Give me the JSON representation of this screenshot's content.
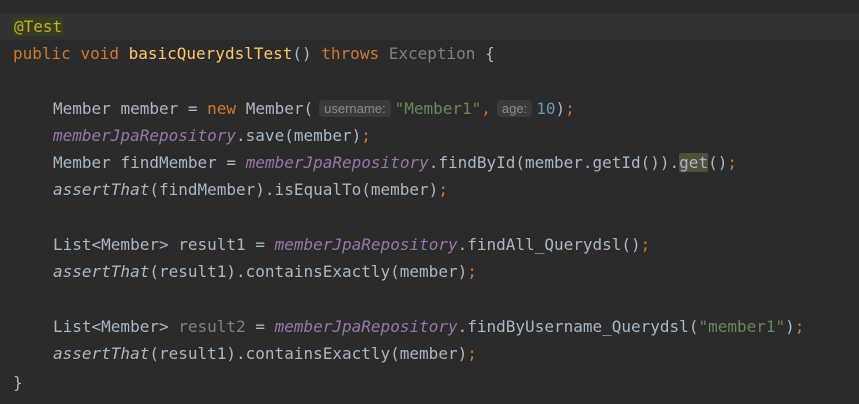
{
  "code": {
    "annotation": "@Test",
    "sig": {
      "kw_public": "public",
      "kw_void": "void",
      "method_name": "basicQuerydslTest",
      "parens": "()",
      "kw_throws": "throws",
      "exception": "Exception",
      "brace_open": "{"
    },
    "l3": {
      "type": "Member",
      "var": "member",
      "eq": "=",
      "kw_new": "new",
      "ctor": "Member(",
      "hint_username": "username:",
      "str_member1": "\"Member1\"",
      "comma": ",",
      "hint_age": "age:",
      "num_age": "10",
      "close": ")",
      "semi": ";"
    },
    "l4": {
      "field": "memberJpaRepository",
      "call": ".save(member)",
      "semi": ";"
    },
    "l5": {
      "type": "Member",
      "var": "findMember",
      "eq": "=",
      "field": "memberJpaRepository",
      "call": ".findById(member.getId()).",
      "get": "get",
      "tail": "()",
      "semi": ";"
    },
    "l6": {
      "fn": "assertThat",
      "call": "(findMember).isEqualTo(member)",
      "semi": ";"
    },
    "l8": {
      "type": "List<Member>",
      "var": "result1",
      "eq": "=",
      "field": "memberJpaRepository",
      "call": ".findAll_Querydsl()",
      "semi": ";"
    },
    "l9": {
      "fn": "assertThat",
      "call": "(result1).containsExactly(member)",
      "semi": ";"
    },
    "l11": {
      "type": "List<Member>",
      "var": "result2",
      "eq": "=",
      "field": "memberJpaRepository",
      "call": ".findByUsername_Querydsl(",
      "str": "\"member1\"",
      "close": ")",
      "semi": ";"
    },
    "l12": {
      "fn": "assertThat",
      "call": "(result1).containsExactly(member)",
      "semi": ";"
    },
    "brace_close": "}"
  },
  "colors": {
    "background": "#2b2b2b",
    "keyword": "#cc7832",
    "method": "#ffc66d",
    "field": "#9876aa",
    "string": "#6a8759",
    "number": "#6897bb",
    "annotation": "#bbb529",
    "text": "#a9b7c6"
  }
}
